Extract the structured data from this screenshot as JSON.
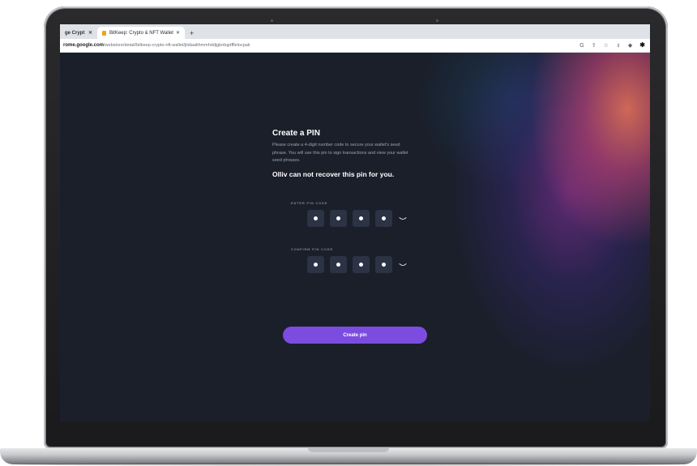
{
  "browser": {
    "tabs": [
      {
        "label": "ge Crypt",
        "active": false
      },
      {
        "label": "BitKeep: Crypto & NFT Wallet",
        "active": true
      }
    ],
    "new_tab_icon": "plus-icon",
    "url_host": "rome.google.com",
    "url_path": "/webstore/detail/bitkeep-crypto-nft-wallet/jiidiaalihmmhddjgbnbgdfflelocpak",
    "toolbar_icons": [
      "google-icon",
      "share-icon",
      "star-icon",
      "profile-icon",
      "extension-icon",
      "puzzle-icon"
    ]
  },
  "pin_setup": {
    "title": "Create a PIN",
    "description": "Please create a 4-digit number code to secure your wallet's seed phrase. You will use this pin to sign transactions and view your wallet seed phrases.",
    "warning": "Olliv can not recover this pin for you.",
    "enter_label": "ENTER PIN CODE",
    "confirm_label": "CONFIRM PIN CODE",
    "enter_digits_filled": 4,
    "confirm_digits_filled": 4,
    "button_label": "Create pin"
  },
  "colors": {
    "page_bg": "#1a1f2a",
    "pin_box": "#2b3344",
    "button": "#7c4ce0"
  }
}
